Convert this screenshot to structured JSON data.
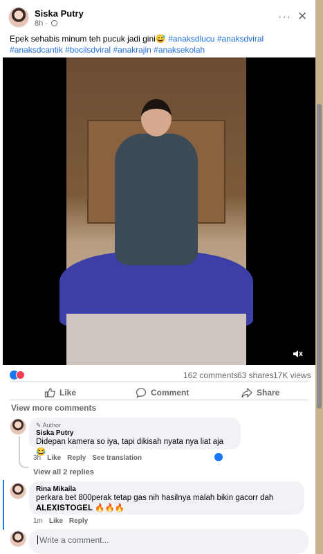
{
  "post": {
    "author": "Siska Putry",
    "time": "8h",
    "caption_text": "Epek sehabis minum teh pucuk jadi gini😅",
    "hashtags": [
      "#anaksdlucu",
      "#anaksdviral",
      "#anaksdcantik",
      "#bocilsdviral",
      "#anakrajin",
      "#anaksekolah"
    ],
    "more_glyph": "···",
    "close_glyph": "✕"
  },
  "stats": {
    "comments": "162 comments",
    "shares": "63 shares",
    "views": "17K views"
  },
  "actions": {
    "like": "Like",
    "comment": "Comment",
    "share": "Share"
  },
  "comments": {
    "view_more": "View more comments",
    "first": {
      "badge": "Author",
      "name": "Siska Putry",
      "text": "Didepan kamera so iya, tapi dikisah nyata nya liat aja 😂",
      "time": "3h",
      "like": "Like",
      "reply": "Reply",
      "translate": "See translation"
    },
    "view_replies": "View all 2 replies",
    "second": {
      "name": "Rina Mikaila",
      "text_line1": "perkara bet 800perak tetap gas nih hasilnya malah bikin gacorr dah",
      "text_line2": "𝐀𝐋𝐄𝐗𝐈𝐒𝐓𝐎𝐆𝐄𝐋 🔥🔥🔥",
      "time": "1m",
      "like": "Like",
      "reply": "Reply"
    },
    "composer_placeholder": "Write a comment..."
  },
  "colors": {
    "accent": "#1877f2",
    "hashtag": "#216fdb",
    "muted": "#65676b",
    "bubble": "#f0f2f5"
  }
}
